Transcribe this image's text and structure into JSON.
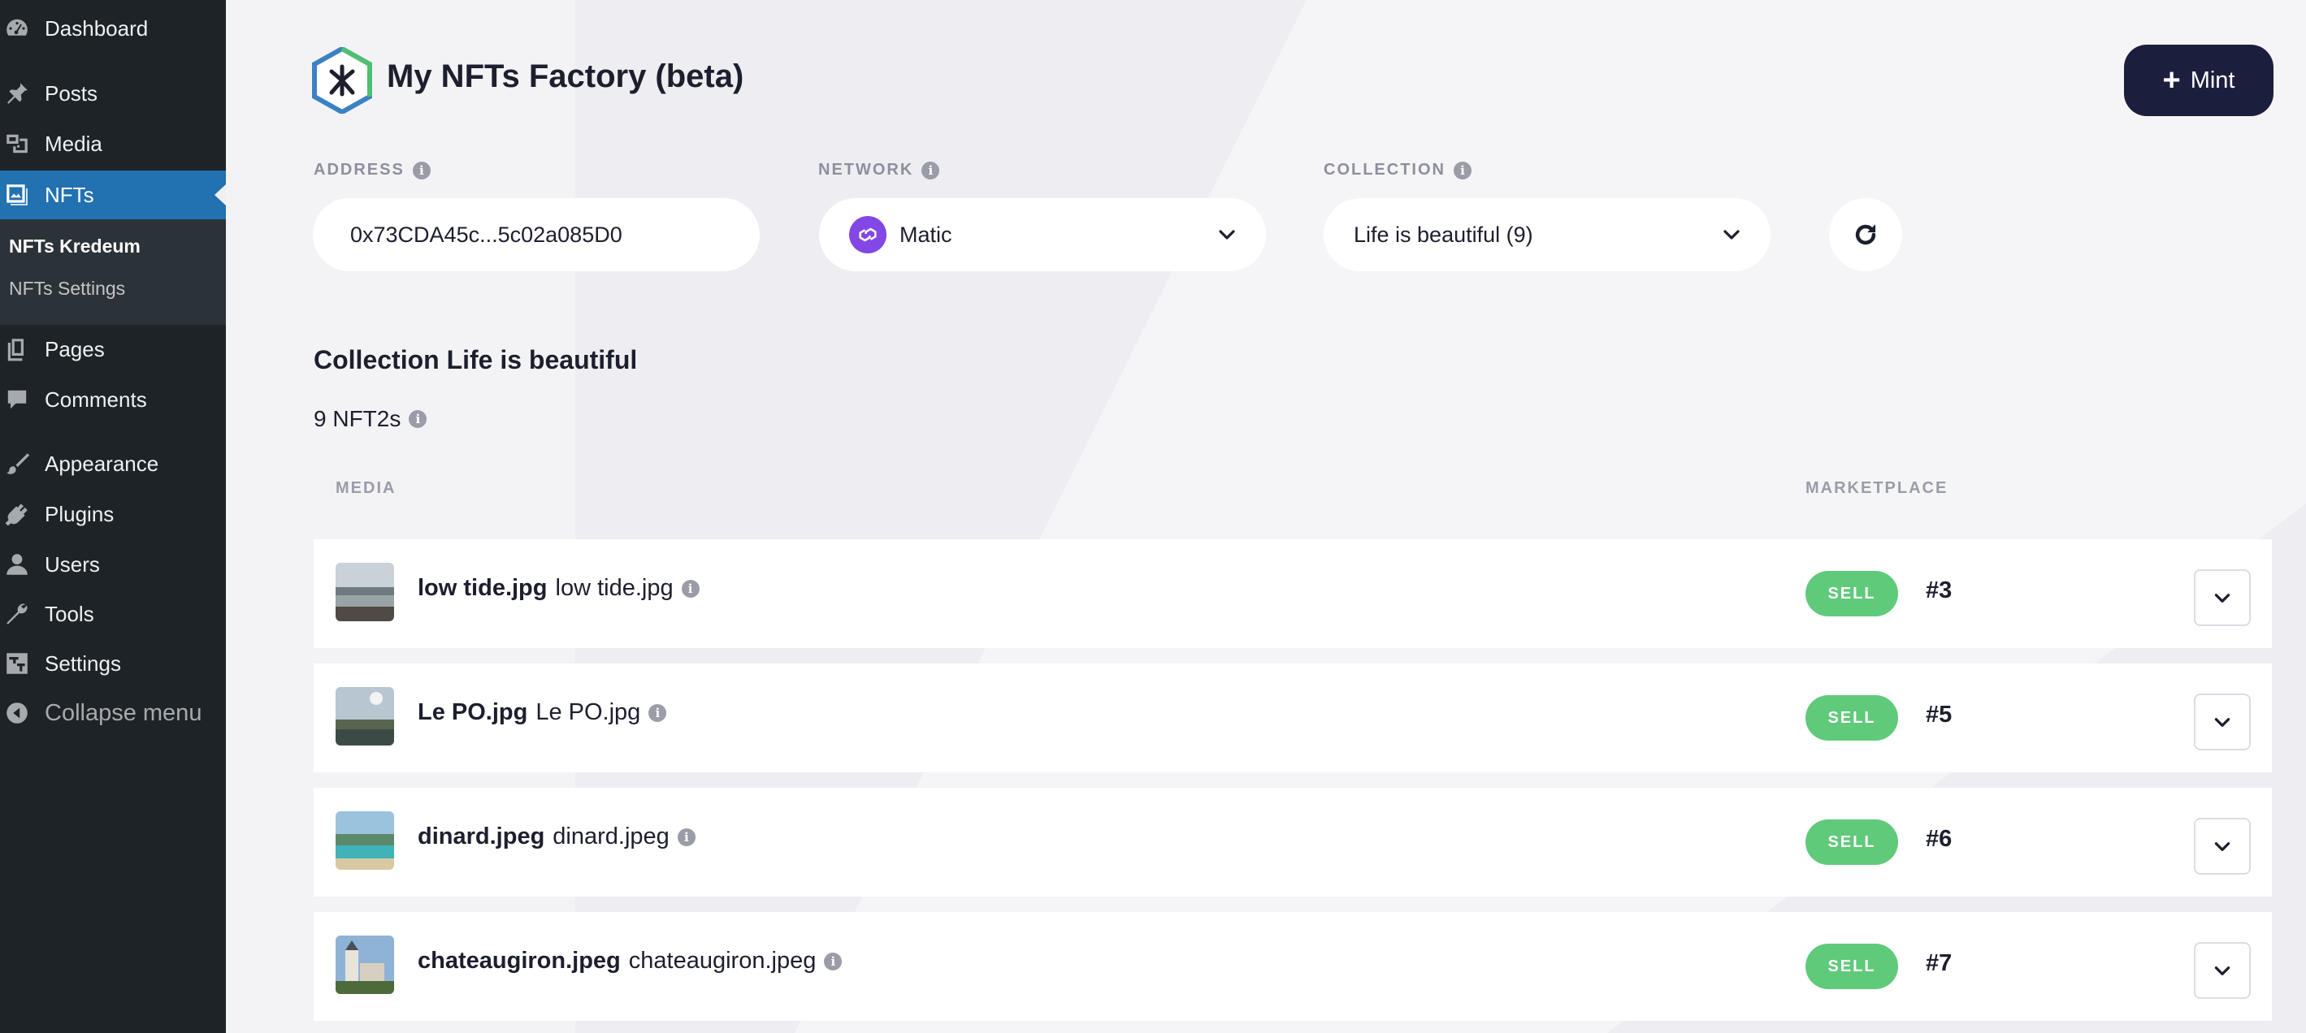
{
  "sidebar": {
    "items": [
      {
        "label": "Dashboard",
        "icon": "dashboard-icon"
      },
      {
        "label": "Posts",
        "icon": "pin-icon"
      },
      {
        "label": "Media",
        "icon": "media-icon"
      },
      {
        "label": "NFTs",
        "icon": "nft-gallery-icon",
        "active": true
      },
      {
        "label": "Pages",
        "icon": "pages-icon"
      },
      {
        "label": "Comments",
        "icon": "comments-icon"
      },
      {
        "label": "Appearance",
        "icon": "brush-icon"
      },
      {
        "label": "Plugins",
        "icon": "plugin-icon"
      },
      {
        "label": "Users",
        "icon": "user-icon"
      },
      {
        "label": "Tools",
        "icon": "wrench-icon"
      },
      {
        "label": "Settings",
        "icon": "settings-icon"
      }
    ],
    "submenu": [
      {
        "label": "NFTs Kredeum",
        "current": true
      },
      {
        "label": "NFTs Settings",
        "current": false
      }
    ],
    "collapse_label": "Collapse menu"
  },
  "header": {
    "title": "My NFTs Factory (beta)",
    "mint_label": "Mint"
  },
  "filters": {
    "address_label": "ADDRESS",
    "address_value": "0x73CDA45c...5c02a085D0",
    "network_label": "NETWORK",
    "network_value": "Matic",
    "collection_label": "COLLECTION",
    "collection_value": "Life is beautiful (9)"
  },
  "collection": {
    "heading": "Collection Life is beautiful",
    "count_text": "9 NFT2s"
  },
  "table": {
    "media_header": "MEDIA",
    "marketplace_header": "MARKETPLACE",
    "rows": [
      {
        "title": "low tide.jpg",
        "subtitle": "low tide.jpg",
        "action": "SELL",
        "token": "#3"
      },
      {
        "title": "Le PO.jpg",
        "subtitle": "Le PO.jpg",
        "action": "SELL",
        "token": "#5"
      },
      {
        "title": "dinard.jpeg",
        "subtitle": "dinard.jpeg",
        "action": "SELL",
        "token": "#6"
      },
      {
        "title": "chateaugiron.jpeg",
        "subtitle": "chateaugiron.jpeg",
        "action": "SELL",
        "token": "#7"
      }
    ]
  },
  "colors": {
    "sidebar_bg": "#1d2327",
    "active_blue": "#2271b1",
    "mint_button": "#1b1e3d",
    "sell_green": "#5fca7a",
    "matic_purple": "#8247e5"
  }
}
